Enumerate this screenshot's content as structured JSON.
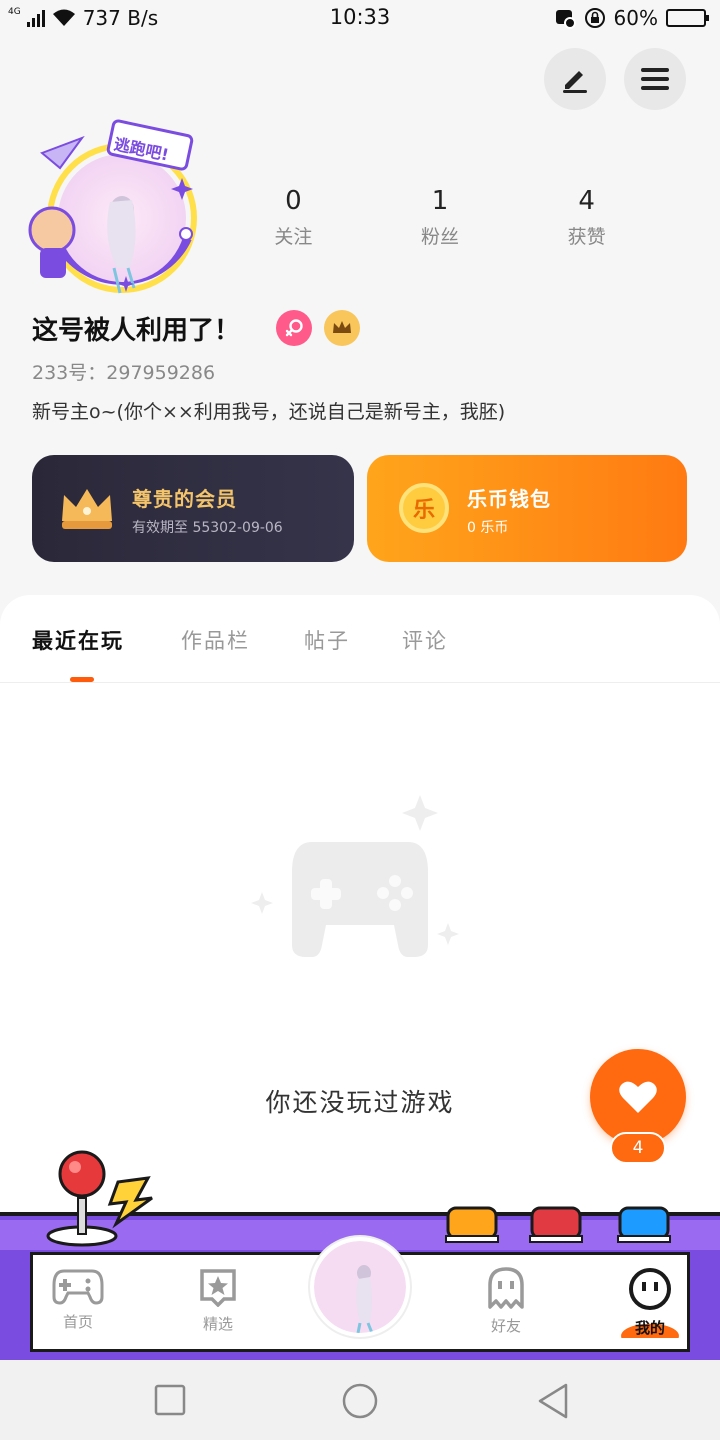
{
  "status_bar": {
    "network": "4G",
    "speed": "737 B/s",
    "time": "10:33",
    "battery": "60%",
    "battery_level": 0.6
  },
  "header": {
    "edit_icon": "pen-icon",
    "menu_icon": "hamburger-icon"
  },
  "profile": {
    "avatar_frame_text": "逃跑吧!",
    "stats": [
      {
        "value": "0",
        "label": "关注"
      },
      {
        "value": "1",
        "label": "粉丝"
      },
      {
        "value": "4",
        "label": "获赞"
      }
    ],
    "nickname": "这号被人利用了！",
    "uid": "233号：297959286",
    "bio": "新号主o~(你个××利用我号，还说自己是新号主，我胚)",
    "gender_badge_icon": "female-icon",
    "vip_badge_icon": "crown-icon"
  },
  "cards": {
    "vip_title": "尊贵的会员",
    "vip_sub": "有效期至 55302-09-06",
    "wallet_title": "乐币钱包",
    "wallet_sub": "0 乐币",
    "wallet_coin_char": "乐"
  },
  "tabs": [
    {
      "label": "最近在玩",
      "active": true
    },
    {
      "label": "作品栏",
      "active": false
    },
    {
      "label": "帖子",
      "active": false
    },
    {
      "label": "评论",
      "active": false
    }
  ],
  "empty_state": {
    "icon": "gamepad-icon",
    "text": "你还没玩过游戏"
  },
  "like_fab": {
    "icon": "heart-icon",
    "count": "4"
  },
  "bottom_nav": [
    {
      "label": "首页",
      "icon": "gamepad-icon",
      "active": false
    },
    {
      "label": "精选",
      "icon": "star-icon",
      "active": false
    },
    {
      "label": "好友",
      "icon": "ghost-icon",
      "active": false
    },
    {
      "label": "我的",
      "icon": "smiley-icon",
      "active": true
    }
  ],
  "colors": {
    "accent": "#ff6a10",
    "tab_indicator": "#ff5b0a",
    "purple": "#7b4ce0",
    "vip_gold": "#f3c46b"
  }
}
